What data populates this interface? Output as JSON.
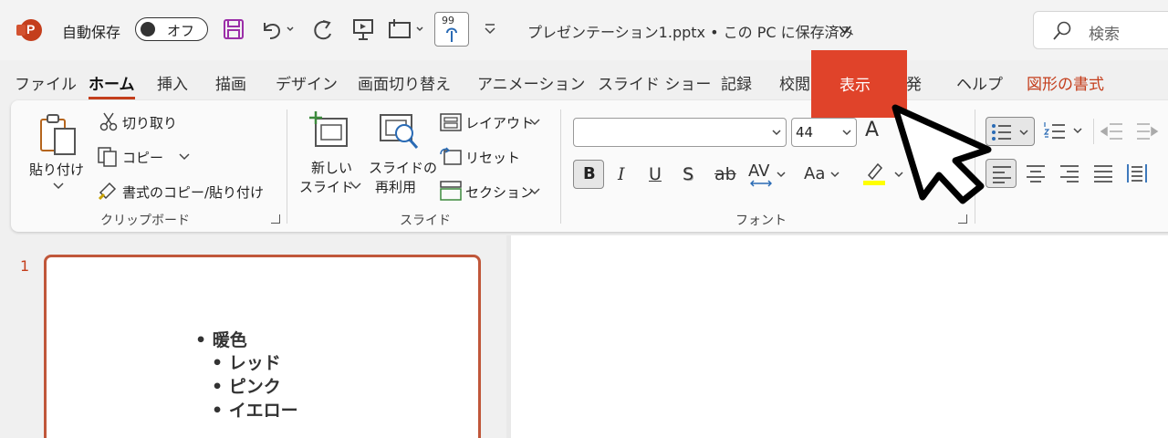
{
  "titlebar": {
    "autosave_label": "自動保存",
    "autosave_state": "オフ",
    "touch_badge": "99",
    "filename": "プレゼンテーション1.pptx • この PC に保存済み",
    "search_placeholder": "検索"
  },
  "tabs": {
    "file": "ファイル",
    "home": "ホーム",
    "insert": "挿入",
    "draw": "描画",
    "design": "デザイン",
    "transitions": "画面切り替え",
    "animations": "アニメーション",
    "slideshow": "スライド ショー",
    "record": "記録",
    "review": "校閲",
    "view": "表示",
    "developer": "開発",
    "help": "ヘルプ",
    "shape_format": "図形の書式"
  },
  "clipboard": {
    "paste": "貼り付け",
    "cut": "切り取り",
    "copy": "コピー",
    "format_painter": "書式のコピー/貼り付け",
    "label": "クリップボード"
  },
  "slides_group": {
    "new_slide_1": "新しい",
    "new_slide_2": "スライド",
    "reuse_1": "スライドの",
    "reuse_2": "再利用",
    "layout": "レイアウト",
    "reset": "リセット",
    "section": "セクション",
    "label": "スライド"
  },
  "font_group": {
    "font_name": "",
    "font_size": "44",
    "bold": "B",
    "italic": "I",
    "underline": "U",
    "shadow": "S",
    "strike": "ab",
    "spacing": "AV",
    "case": "Aa",
    "grow": "A",
    "label": "フォント"
  },
  "slide_pane": {
    "number": "1",
    "bullets": [
      "暖色",
      "レッド",
      "ピンク",
      "イエロー"
    ]
  },
  "colors": {
    "accent": "#c43e1c",
    "highlight": "#e0432a",
    "highlight_yellow": "#ffff00"
  }
}
